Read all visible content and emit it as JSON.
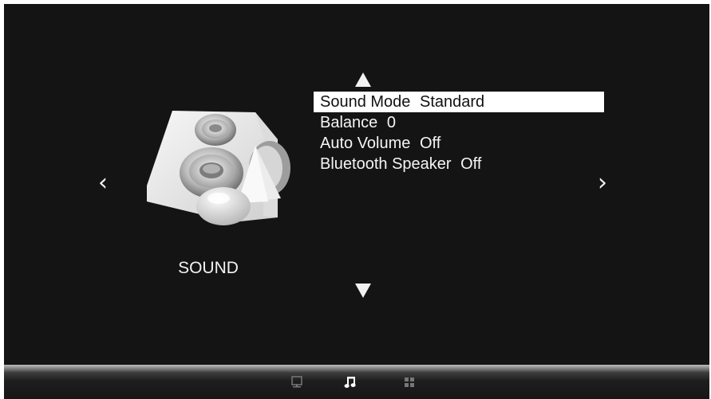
{
  "colors": {
    "background": "#141414",
    "text": "#f2f2f2",
    "selection_background": "#ffffff",
    "selection_text": "#111111",
    "inactive_icon": "#777777"
  },
  "navigation": {
    "prev_icon": "chevron-left-icon",
    "prev_glyph": "‹",
    "next_icon": "chevron-right-icon",
    "next_glyph": "›",
    "scroll_up_icon": "triangle-up-icon",
    "scroll_down_icon": "triangle-down-icon"
  },
  "category": {
    "icon": "speaker-icon",
    "label": "SOUND"
  },
  "menu": {
    "items": [
      {
        "label": "Sound Mode",
        "value": "Standard",
        "selected": true
      },
      {
        "label": "Balance",
        "value": "0",
        "selected": false
      },
      {
        "label": "Auto Volume",
        "value": "Off",
        "selected": false
      },
      {
        "label": "Bluetooth Speaker",
        "value": "Off",
        "selected": false
      }
    ]
  },
  "bottom_bar": {
    "icons": [
      {
        "name": "picture-icon",
        "active": false
      },
      {
        "name": "music-note-icon",
        "active": true
      },
      {
        "name": "apps-grid-icon",
        "active": false
      }
    ]
  }
}
